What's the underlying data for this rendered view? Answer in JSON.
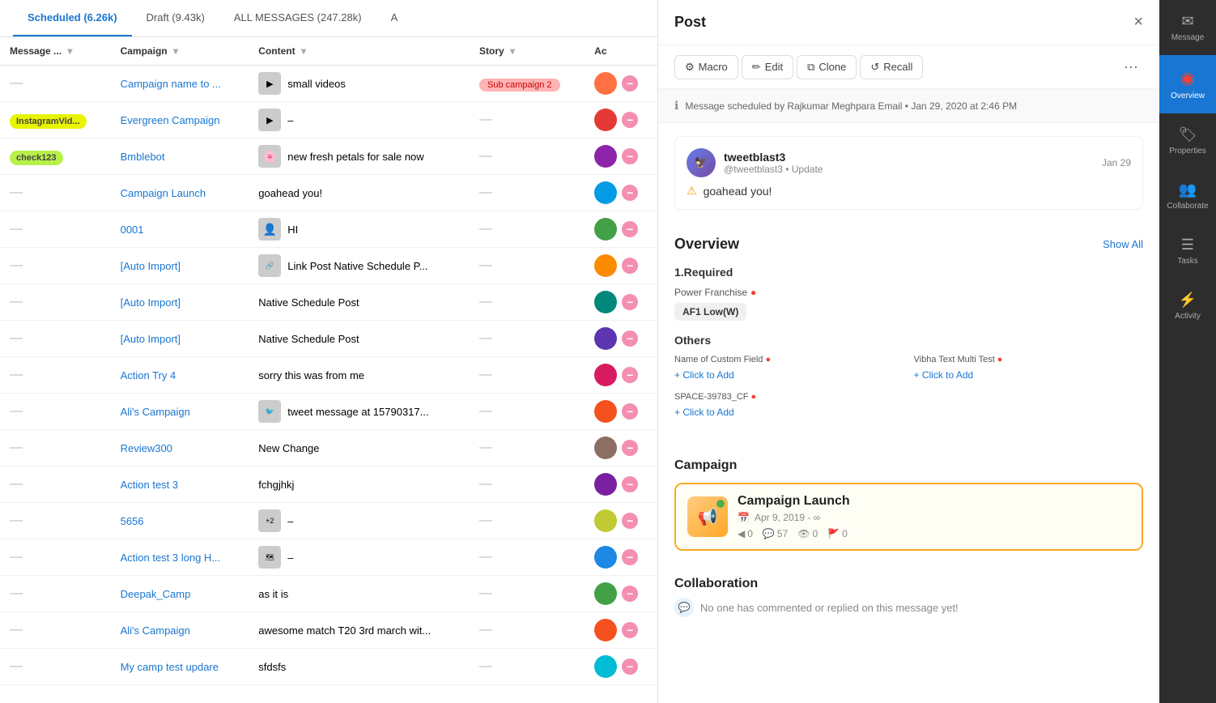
{
  "tabs": [
    {
      "label": "Scheduled (6.26k)",
      "active": true
    },
    {
      "label": "Draft (9.43k)",
      "active": false
    },
    {
      "label": "ALL MESSAGES (247.28k)",
      "active": false
    },
    {
      "label": "A",
      "active": false
    }
  ],
  "table": {
    "columns": [
      "Message ...",
      "Campaign",
      "Content",
      "Story",
      "Ac"
    ],
    "rows": [
      {
        "msg": "—",
        "msg_color": "",
        "campaign": "Campaign name to ...",
        "content_text": "small videos",
        "has_thumb": true,
        "thumb_type": "video",
        "story": "Sub campaign 2",
        "story_type": "sub",
        "avatar_color": "#ff7043"
      },
      {
        "msg": "InstagramVid...",
        "msg_color": "yellow",
        "campaign": "Evergreen Campaign",
        "content_text": "–",
        "has_thumb": true,
        "thumb_type": "play",
        "story": "—",
        "story_type": "dash",
        "avatar_color": "#e53935"
      },
      {
        "msg": "check123",
        "msg_color": "green",
        "campaign": "Bmblebot",
        "content_text": "new fresh petals for sale now",
        "has_thumb": true,
        "thumb_type": "flower",
        "story": "—",
        "story_type": "dash",
        "avatar_color": "#8e24aa"
      },
      {
        "msg": "—",
        "msg_color": "",
        "campaign": "Campaign Launch",
        "content_text": "goahead you!",
        "has_thumb": false,
        "story": "—",
        "story_type": "dash",
        "avatar_color": "#039be5"
      },
      {
        "msg": "—",
        "msg_color": "",
        "campaign": "0001",
        "content_text": "HI",
        "has_thumb": true,
        "thumb_type": "person",
        "story": "—",
        "story_type": "dash",
        "avatar_color": "#43a047"
      },
      {
        "msg": "—",
        "msg_color": "",
        "campaign": "[Auto Import]",
        "content_text": "Link Post Native Schedule P...",
        "has_thumb": true,
        "thumb_type": "link",
        "story": "—",
        "story_type": "dash",
        "avatar_color": "#fb8c00"
      },
      {
        "msg": "—",
        "msg_color": "",
        "campaign": "[Auto Import]",
        "content_text": "Native Schedule Post",
        "has_thumb": false,
        "story": "—",
        "story_type": "dash",
        "avatar_color": "#00897b"
      },
      {
        "msg": "—",
        "msg_color": "",
        "campaign": "[Auto Import]",
        "content_text": "Native Schedule Post",
        "has_thumb": false,
        "story": "—",
        "story_type": "dash",
        "avatar_color": "#5e35b1"
      },
      {
        "msg": "—",
        "msg_color": "",
        "campaign": "Action Try 4",
        "content_text": "sorry this was from me",
        "has_thumb": false,
        "story": "—",
        "story_type": "dash",
        "avatar_color": "#d81b60"
      },
      {
        "msg": "—",
        "msg_color": "",
        "campaign": "Ali's Campaign",
        "content_text": "tweet message at 15790317...",
        "has_thumb": true,
        "thumb_type": "tweet",
        "story": "—",
        "story_type": "dash",
        "avatar_color": "#f4511e"
      },
      {
        "msg": "—",
        "msg_color": "",
        "campaign": "Review300",
        "content_text": "New Change",
        "has_thumb": false,
        "story": "—",
        "story_type": "dash",
        "avatar_color": "#8d6e63"
      },
      {
        "msg": "—",
        "msg_color": "",
        "campaign": "Action test 3",
        "content_text": "fchgjhkj",
        "has_thumb": false,
        "story": "—",
        "story_type": "dash",
        "avatar_color": "#7b1fa2"
      },
      {
        "msg": "—",
        "msg_color": "",
        "campaign": "5656",
        "content_text": "–",
        "has_thumb": true,
        "thumb_type": "qr",
        "story": "—",
        "story_type": "dash",
        "avatar_color": "#c0ca33"
      },
      {
        "msg": "—",
        "msg_color": "",
        "campaign": "Action test 3 long H...",
        "content_text": "–",
        "has_thumb": true,
        "thumb_type": "map",
        "story": "—",
        "story_type": "dash",
        "avatar_color": "#1e88e5"
      },
      {
        "msg": "—",
        "msg_color": "",
        "campaign": "Deepak_Camp",
        "content_text": "as it is",
        "has_thumb": false,
        "story": "—",
        "story_type": "dash",
        "avatar_color": "#43a047"
      },
      {
        "msg": "—",
        "msg_color": "",
        "campaign": "Ali's Campaign",
        "content_text": "awesome match T20 3rd march wit...",
        "has_thumb": false,
        "story": "—",
        "story_type": "dash",
        "avatar_color": "#f4511e"
      },
      {
        "msg": "—",
        "msg_color": "",
        "campaign": "My camp test updare",
        "content_text": "sfdsfs",
        "has_thumb": false,
        "story": "—",
        "story_type": "dash",
        "avatar_color": "#00bcd4"
      }
    ]
  },
  "post_panel": {
    "title": "Post",
    "close": "×",
    "actions": [
      {
        "label": "Macro",
        "icon": "⚙"
      },
      {
        "label": "Edit",
        "icon": "✏"
      },
      {
        "label": "Clone",
        "icon": "⧉"
      },
      {
        "label": "Recall",
        "icon": "↺"
      }
    ],
    "info": "Message scheduled by Rajkumar Meghpara Email • Jan 29, 2020 at 2:46 PM",
    "message": {
      "user": "tweetblast3",
      "handle": "@tweetblast3 • Update",
      "date": "Jan 29",
      "content": "goahead you!"
    },
    "overview": {
      "title": "Overview",
      "show_all": "Show All",
      "required_title": "1.Required",
      "power_franchise_label": "Power Franchise",
      "franchise_tag": "AF1 Low(W)",
      "others_title": "Others",
      "fields": [
        {
          "label": "Name of Custom Field",
          "add": "+ Click to Add"
        },
        {
          "label": "Vibha Text Multi Test",
          "add": "+ Click to Add"
        },
        {
          "label": "SPACE-39783_CF",
          "add": "+ Click to Add"
        }
      ]
    },
    "campaign": {
      "title": "Campaign",
      "name": "Campaign Launch",
      "dates": "Apr 9, 2019 - ∞",
      "stats": {
        "send": "0",
        "comments": "57",
        "views": "0",
        "flags": "0"
      }
    },
    "collaboration": {
      "title": "Collaboration",
      "message": "No one has commented or replied on this message yet!"
    }
  },
  "sidebar": {
    "items": [
      {
        "label": "Message",
        "icon": "✉",
        "active": false,
        "badge": null
      },
      {
        "label": "Overview",
        "icon": "◉",
        "active": true,
        "badge": null
      },
      {
        "label": "Properties",
        "icon": "🏷",
        "active": false,
        "badge": null
      },
      {
        "label": "Collaborate",
        "icon": "👥",
        "active": false,
        "badge": null
      },
      {
        "label": "Tasks",
        "icon": "☰",
        "active": false,
        "badge": null
      },
      {
        "label": "Activity",
        "icon": "⚡",
        "active": false,
        "badge": null
      }
    ]
  }
}
